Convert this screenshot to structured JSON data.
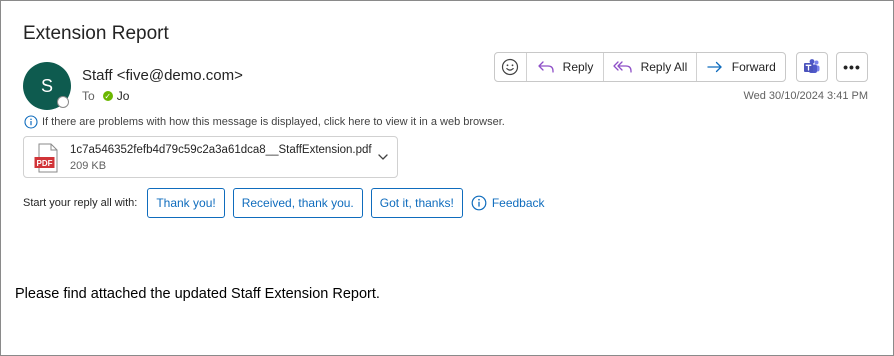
{
  "message": {
    "subject": "Extension Report",
    "sender_initial": "S",
    "sender": "Staff <five@demo.com>",
    "to_label": "To",
    "recipient": "Jo",
    "date": "Wed 30/10/2024 3:41 PM",
    "info_notice": "If there are problems with how this message is displayed, click here to view it in a web browser.",
    "body": "Please find attached the updated Staff Extension Report."
  },
  "actions": {
    "reply": "Reply",
    "reply_all": "Reply All",
    "forward": "Forward",
    "more": "•••"
  },
  "attachment": {
    "name": "1c7a546352fefb4d79c59c2a3a61dca8__StaffExtension.pdf",
    "size": "209 KB",
    "type_label": "PDF"
  },
  "suggested_replies": {
    "label": "Start your reply all with:",
    "options": [
      "Thank you!",
      "Received, thank you.",
      "Got it, thanks!"
    ],
    "feedback": "Feedback"
  },
  "icons": {
    "emoji": "emoji-icon",
    "reply": "reply-icon",
    "reply_all": "reply-all-icon",
    "forward": "forward-icon",
    "teams": "teams-icon",
    "more": "more-icon",
    "info": "info-icon",
    "pdf": "pdf-icon",
    "chevron": "chevron-down-icon"
  },
  "colors": {
    "avatar_bg": "#0e5b4f",
    "accent": "#0f6cbd",
    "reply_icon": "#8e4fc7",
    "presence_check": "#6bb700",
    "pdf_red": "#d13438",
    "teams": "#4b53bc"
  }
}
